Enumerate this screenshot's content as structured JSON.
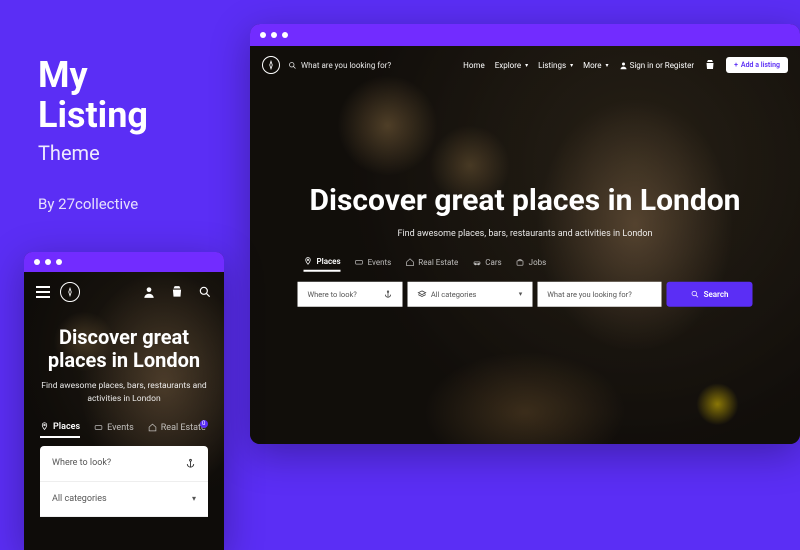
{
  "promo": {
    "title_line1": "My",
    "title_line2": "Listing",
    "subtitle": "Theme",
    "author": "By 27collective"
  },
  "nav": {
    "search_placeholder": "What are you looking for?",
    "home": "Home",
    "explore": "Explore",
    "listings": "Listings",
    "more": "More",
    "signin": "Sign in or Register",
    "add_listing": "Add a listing"
  },
  "hero": {
    "title": "Discover great places in London",
    "subtitle": "Find awesome places, bars, restaurants and activities in London"
  },
  "tabs": {
    "places": "Places",
    "events": "Events",
    "real_estate": "Real Estate",
    "cars": "Cars",
    "jobs": "Jobs"
  },
  "search": {
    "where": "Where to look?",
    "categories": "All categories",
    "what": "What are you looking for?",
    "button": "Search"
  },
  "mobile": {
    "title": "Discover great places in London",
    "subtitle": "Find awesome places, bars, restaurants and activities in London",
    "badge_count": "0"
  },
  "colors": {
    "primary": "#5b2ef5"
  }
}
